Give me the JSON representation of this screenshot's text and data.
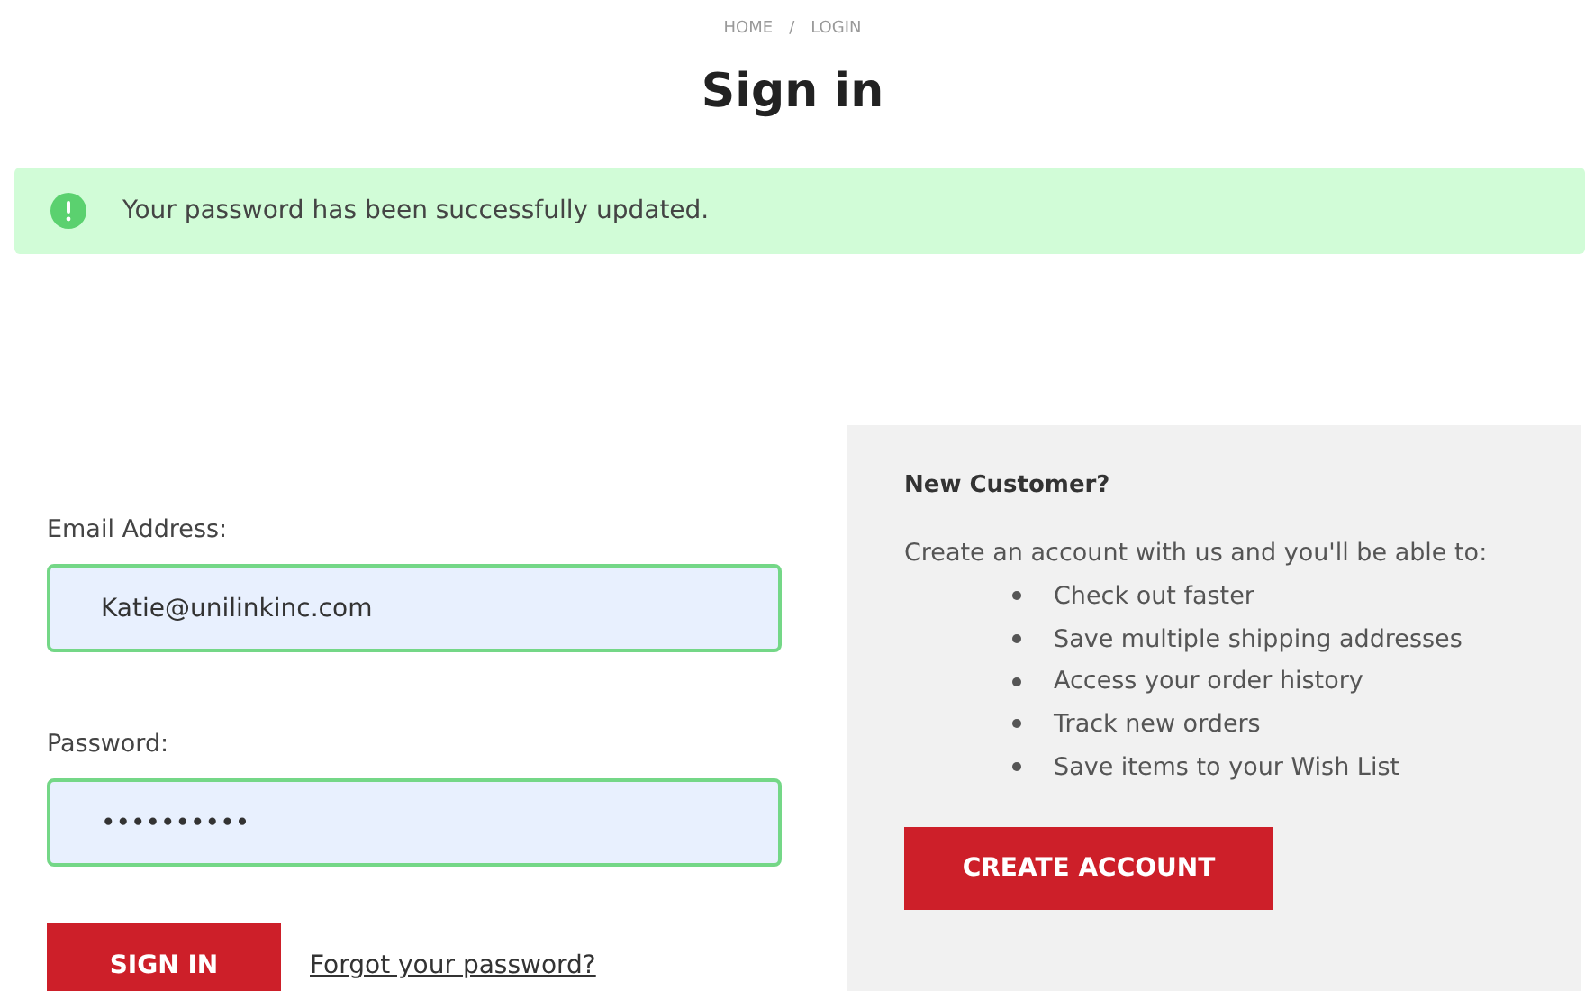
{
  "breadcrumb": [
    "HOME",
    "/",
    "LOGIN"
  ],
  "title": "Sign in",
  "alert": {
    "message": "Your password has been successfully updated."
  },
  "login": {
    "fields": [
      {
        "label": "Email Address:",
        "value": "Katie@unilinkinc.com"
      },
      {
        "label": "Password:",
        "value": "••••••••••"
      }
    ],
    "submit": "SIGN IN",
    "forgot_link": "Forgot your password?"
  },
  "new_customer": {
    "heading": "New Customer?",
    "intro": "Create an account with us and you'll be able to:",
    "benefits": [
      "Check out faster",
      "Save multiple shipping addresses",
      "Access your order history",
      "Track new orders",
      "Save items to your Wish List"
    ],
    "button": "CREATE ACCOUNT"
  }
}
